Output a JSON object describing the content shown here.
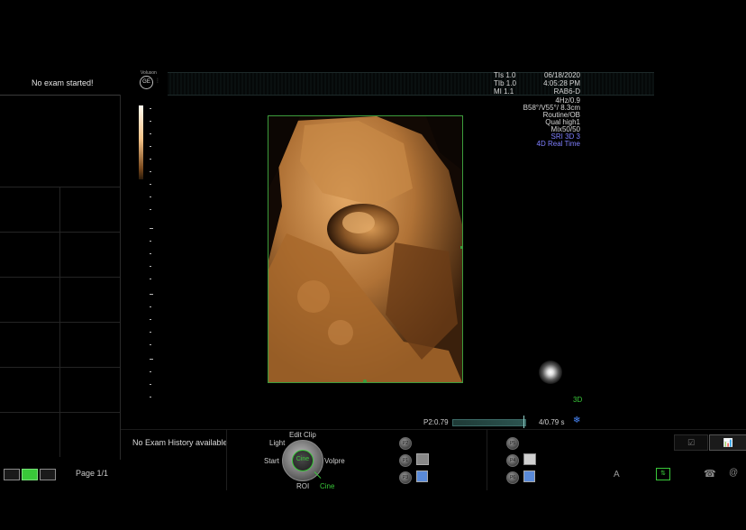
{
  "exam": {
    "status": "No exam started!",
    "history": "No Exam History available",
    "page": "Page 1/1"
  },
  "header": {
    "brand": "Voluson",
    "ge_logo": "GE"
  },
  "info": {
    "tis": "TIs  1.0",
    "tib": "TIb  1.0",
    "mi": "MI  1.1",
    "date": "06/18/2020",
    "time": "4:05:28 PM",
    "probe": "RAB6-D",
    "freq": "4Hz/0.9",
    "angles": "B58°/V55°/ 8.3cm",
    "preset": "Routine/OB",
    "quality": "Qual high1",
    "mix": "Mix50/50",
    "sri": "SRI 3D 3",
    "mode": "4D Real Time"
  },
  "cine": {
    "left_label": "P2:0.79",
    "right_label": "4/0.79 s",
    "mode_3d": "3D"
  },
  "knob": {
    "top": "Edit Clip",
    "left_top": "Light",
    "left": "Start",
    "center": "Cine",
    "right": "Volpre",
    "bottom": "ROI",
    "bottom_right": "Cine"
  },
  "buttons": {
    "p1": "P1",
    "p2": "P2",
    "p3": "P3",
    "p4": "P4",
    "p5": "P5",
    "p6": "P6",
    "a_label": "A"
  },
  "colors": {
    "accent": "#39c839",
    "roi_border": "#3c9c3c",
    "info_blue": "#7f7fff"
  }
}
